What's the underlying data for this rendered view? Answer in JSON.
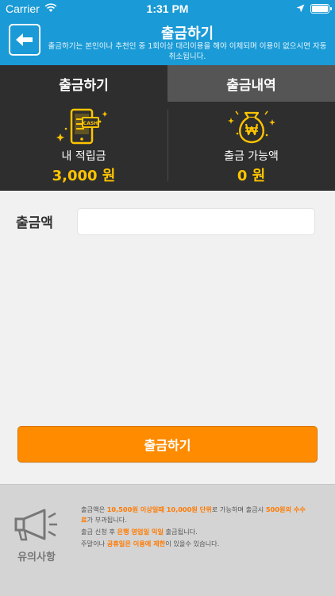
{
  "status_bar": {
    "carrier": "Carrier",
    "time": "1:31 PM"
  },
  "header": {
    "back_icon": "arrow-left-icon",
    "title": "출금하기",
    "subtitle": "출금하기는 본인이나 추천인 중 1회이상 대리이용을 해야 이체되며 이용이 없으시면 자동 취소됩니다."
  },
  "tabs": [
    {
      "label": "출금하기",
      "active": true
    },
    {
      "label": "출금내역",
      "active": false
    }
  ],
  "summary": {
    "points": {
      "icon": "phone-cash-icon",
      "label": "내 적립금",
      "value": "3,000 원"
    },
    "withdrawable": {
      "icon": "money-bag-won-icon",
      "label": "출금 가능액",
      "value": "0 원"
    }
  },
  "form": {
    "amount_label": "출금액",
    "amount_value": "",
    "amount_placeholder": ""
  },
  "submit": {
    "label": "출금하기"
  },
  "notice": {
    "icon": "megaphone-icon",
    "title": "유의사항",
    "line1": [
      {
        "text": "출금액은 ",
        "hl": false
      },
      {
        "text": "10,500원 이상일때 10,000원 단위",
        "hl": true
      },
      {
        "text": "로 가능하며 출금시 ",
        "hl": false
      },
      {
        "text": "500원의 수수료",
        "hl": true
      },
      {
        "text": "가 부과됩니다.",
        "hl": false
      }
    ],
    "line2": [
      {
        "text": "출금 신청 후 ",
        "hl": false
      },
      {
        "text": "은행 영업일 익일",
        "hl": true
      },
      {
        "text": " 출금됩니다.",
        "hl": false
      }
    ],
    "line3": [
      {
        "text": "주말이나 ",
        "hl": false
      },
      {
        "text": "공휴일은 이용에 제한",
        "hl": true
      },
      {
        "text": "이 있을수 있습니다.",
        "hl": false
      }
    ]
  },
  "colors": {
    "header": "#1a9ad6",
    "panel": "#2e2e2e",
    "accent": "#ff8c00",
    "value": "#ffc400"
  }
}
